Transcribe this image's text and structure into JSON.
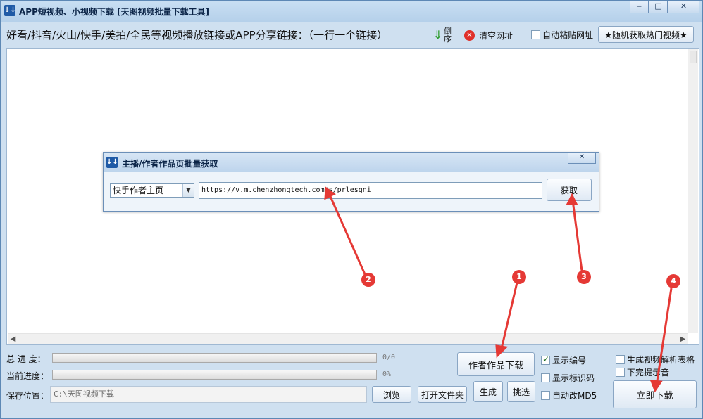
{
  "window": {
    "title": "APP短视频、小视频下载 [天图视频批量下载工具]",
    "icon_text": "↓↓",
    "controls": {
      "minimize": "‒",
      "maximize": "□",
      "close": "✕"
    }
  },
  "toolbar": {
    "hint": "好看/抖音/火山/快手/美拍/全民等视频播放链接或APP分享链接：（一行一个链接）",
    "reverse_label": "倒序",
    "reverse_icon": "⇓",
    "clear_label": "清空网址",
    "clear_icon": "✕",
    "auto_paste_label": "自动粘贴网址",
    "auto_paste_checked": false,
    "random_hot_label": "★随机获取热门视频★"
  },
  "dialog": {
    "title": "主播/作者作品页批量获取",
    "close_label": "✕",
    "source_type": "快手作者主页",
    "url_value": "https://v.m.chenzhongtech.com/s/prlesgni",
    "fetch_label": "获取"
  },
  "bottom": {
    "total_progress_label": "总 进 度：",
    "total_progress_text": "0/0",
    "total_progress_value": 0,
    "current_progress_label": "当前进度：",
    "current_progress_text": "0%",
    "current_progress_value": 0,
    "save_location_label": "保存位置：",
    "save_path": "C:\\天图视频下载",
    "browse_label": "浏览",
    "open_folder_label": "打开文件夹",
    "author_download_label": "作者作品下载",
    "generate_label": "生成",
    "pick_label": "挑选",
    "show_number_label": "显示编号",
    "show_number_checked": true,
    "show_watermark_label": "显示标识码",
    "show_watermark_checked": false,
    "auto_md5_label": "自动改MD5",
    "auto_md5_checked": false,
    "gen_table_label": "生成视频解析表格",
    "gen_table_checked": false,
    "finish_sound_label": "下完提示音",
    "finish_sound_checked": false,
    "download_now_label": "立即下载"
  },
  "annotations": [
    "1",
    "2",
    "3",
    "4"
  ],
  "colors": {
    "accent": "#e53935",
    "window_bg": "#cfe0f0",
    "progress_fill": "#2fb14d"
  }
}
